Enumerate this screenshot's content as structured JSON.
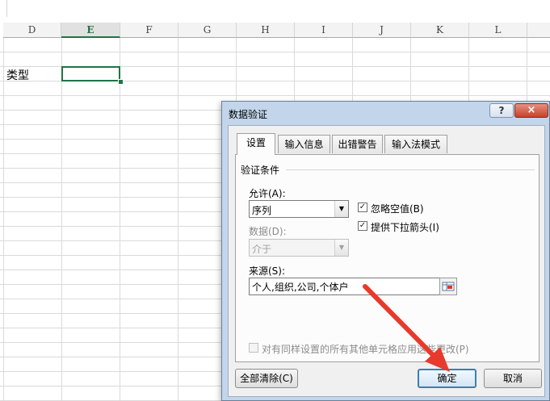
{
  "sheet": {
    "columns": [
      "D",
      "E",
      "F",
      "G",
      "H",
      "I",
      "J",
      "K",
      "L"
    ],
    "active_column": "E",
    "cell_text": "类型"
  },
  "dialog": {
    "title": "数据验证",
    "help_label": "?",
    "close_label": "×",
    "tabs": [
      "设置",
      "输入信息",
      "出错警告",
      "输入法模式"
    ],
    "active_tab": "设置",
    "group_label": "验证条件",
    "allow_label": "允许(A):",
    "allow_value": "序列",
    "ignore_blank_label": "忽略空值(B)",
    "ignore_blank_checked": true,
    "dropdown_label": "提供下拉箭头(I)",
    "dropdown_checked": true,
    "data_label": "数据(D):",
    "data_value": "介于",
    "source_label": "来源(S):",
    "source_value": "个人,组织,公司,个体户",
    "apply_all_label": "对有同样设置的所有其他单元格应用这些更改(P)",
    "apply_all_checked": false,
    "clear_all_label": "全部清除(C)",
    "ok_label": "确定",
    "cancel_label": "取消"
  },
  "colors": {
    "excel_green": "#217346",
    "annotation_arrow": "#e83a2c"
  },
  "icons": [
    "range-selector-icon",
    "dropdown-arrow-icon",
    "checkmark-icon"
  ]
}
